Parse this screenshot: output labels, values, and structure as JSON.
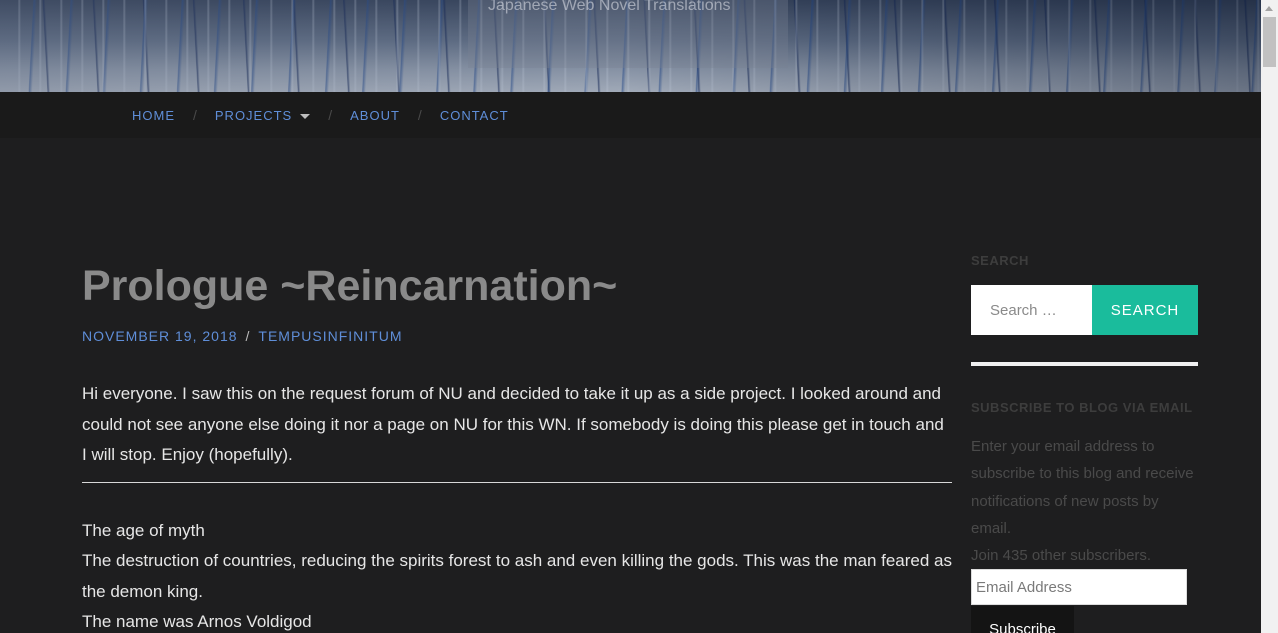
{
  "header": {
    "tagline": "Japanese Web Novel Translations"
  },
  "nav": {
    "items": [
      {
        "label": "HOME"
      },
      {
        "label": "PROJECTS",
        "has_dropdown": true
      },
      {
        "label": "ABOUT"
      },
      {
        "label": "CONTACT"
      }
    ],
    "separator": "/"
  },
  "post": {
    "title": "Prologue ~Reincarnation~",
    "date": "NOVEMBER 19, 2018",
    "meta_separator": "/",
    "author": "TEMPUSINFINITUM",
    "intro": "Hi everyone. I saw this on the request forum of NU and decided to take it up as a side project. I looked around and could not see anyone else doing it nor a page on NU for this WN. If somebody is doing this please get in touch and I will stop. Enjoy (hopefully).",
    "lines": [
      "The age of myth",
      "The destruction of countries, reducing the spirits forest to ash and even killing the gods. This was the man feared as the demon king.",
      "The name was Arnos Voldigod"
    ]
  },
  "sidebar": {
    "search": {
      "title": "SEARCH",
      "placeholder": "Search …",
      "button_label": "SEARCH"
    },
    "subscribe": {
      "title": "SUBSCRIBE TO BLOG VIA EMAIL",
      "description": "Enter your email address to subscribe to this blog and receive notifications of new posts by email.",
      "subscribers": "Join 435 other subscribers.",
      "email_placeholder": "Email Address",
      "button_label": "Subscribe"
    }
  },
  "colors": {
    "background": "#1e1e1f",
    "nav_background": "#1a1a1a",
    "link": "#5f8ed8",
    "accent": "#1abc9c",
    "title": "#8a8a8a",
    "body_text": "#e6e6e6"
  }
}
